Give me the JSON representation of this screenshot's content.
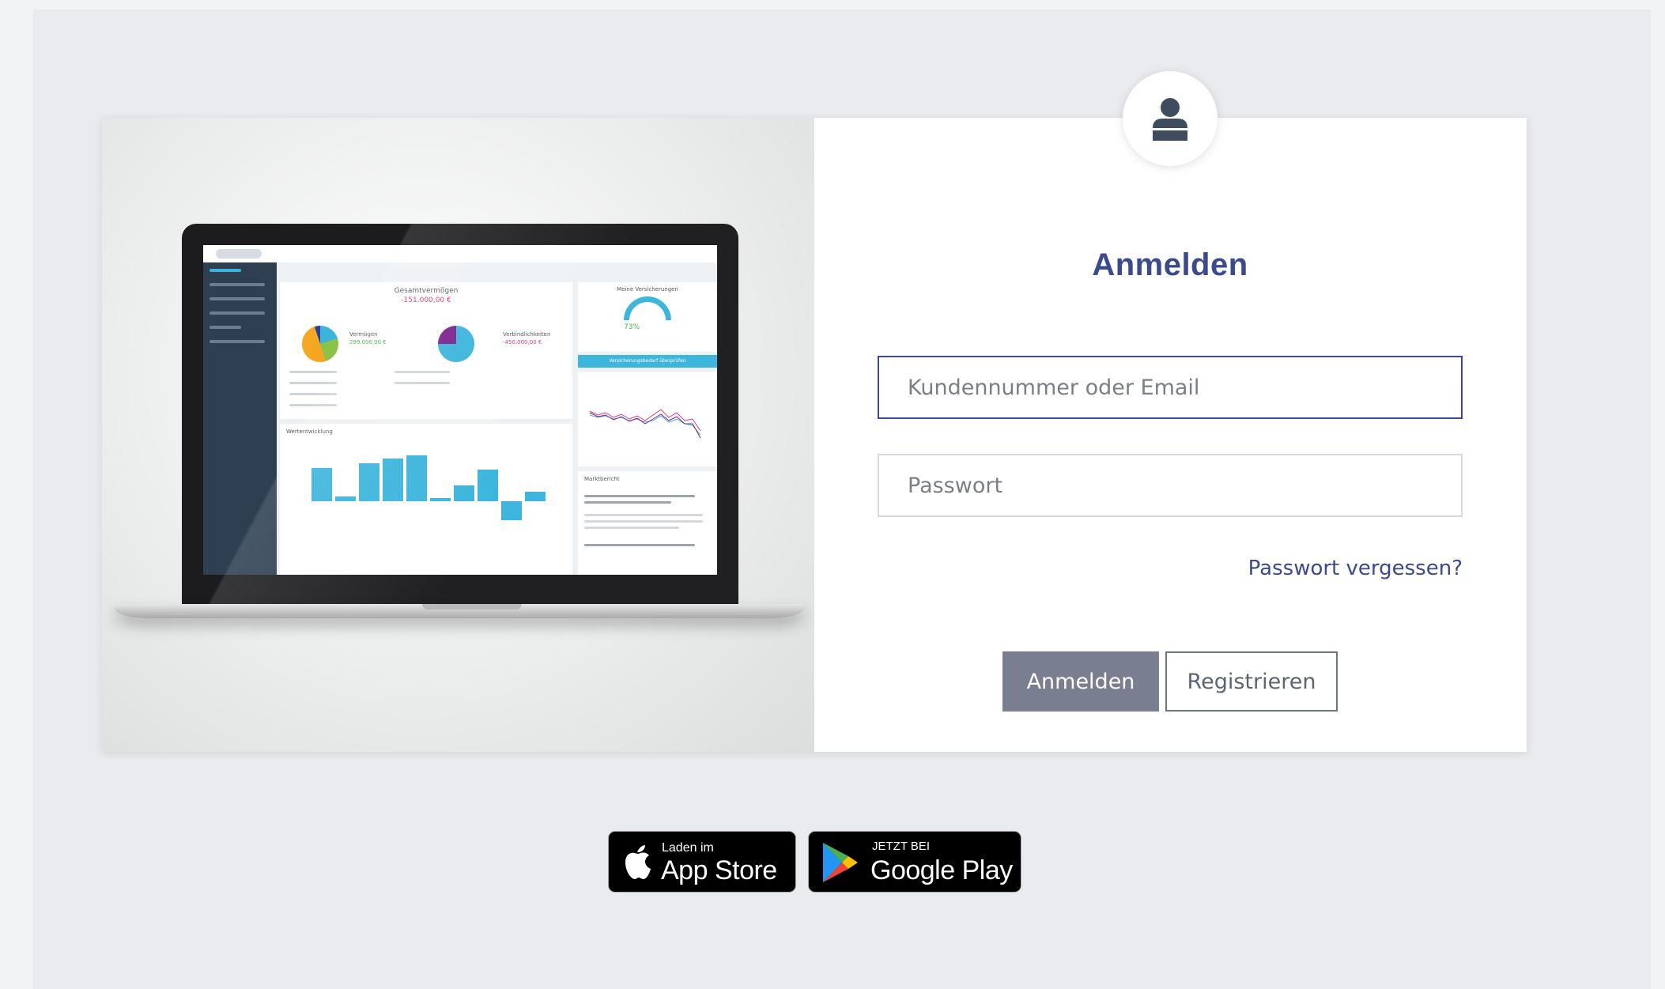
{
  "login": {
    "title": "Anmelden",
    "username_placeholder": "Kundennummer oder Email",
    "password_placeholder": "Passwort",
    "forgot_password": "Passwort vergessen?",
    "submit_label": "Anmelden",
    "register_label": "Registrieren"
  },
  "preview": {
    "total_label": "Gesamtvermögen",
    "total_value": "-151.000,00 €",
    "assets_label": "Vermögen",
    "assets_value": "299.000,00 €",
    "liabilities_label": "Verbindlichkeiten",
    "liabilities_value": "-450.000,00 €",
    "insurance_label": "Meine Versicherungen",
    "insurance_percent": "73%",
    "insurance_button": "Versicherungsbedarf überprüfen",
    "development_label": "Wertentwicklung",
    "news_label": "Marktbericht"
  },
  "stores": {
    "apple_small": "Laden im",
    "apple_big": "App Store",
    "google_small": "JETZT BEI",
    "google_big": "Google Play"
  },
  "colors": {
    "accent": "#3b4a8c",
    "primary_button": "#7a7e91",
    "page_bg": "#e9ebef"
  }
}
